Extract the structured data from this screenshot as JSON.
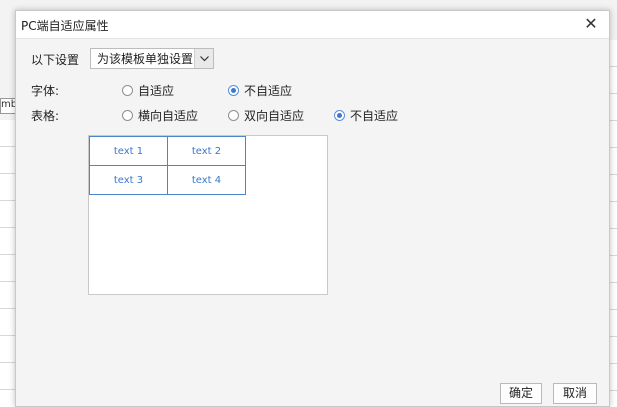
{
  "background": {
    "tab_text": "mbe"
  },
  "dialog": {
    "title": "PC端自适应属性",
    "close_glyph": "✕",
    "setting": {
      "label": "以下设置",
      "selected": "为该模板单独设置"
    },
    "font_row": {
      "label": "字体:",
      "options": [
        {
          "label": "自适应",
          "checked": false
        },
        {
          "label": "不自适应",
          "checked": true
        }
      ]
    },
    "table_row": {
      "label": "表格:",
      "options": [
        {
          "label": "横向自适应",
          "checked": false
        },
        {
          "label": "双向自适应",
          "checked": false
        },
        {
          "label": "不自适应",
          "checked": true
        }
      ]
    },
    "preview_cells": [
      [
        "text 1",
        "text 2"
      ],
      [
        "text 3",
        "text 4"
      ]
    ],
    "buttons": {
      "ok": "确定",
      "cancel": "取消"
    }
  }
}
